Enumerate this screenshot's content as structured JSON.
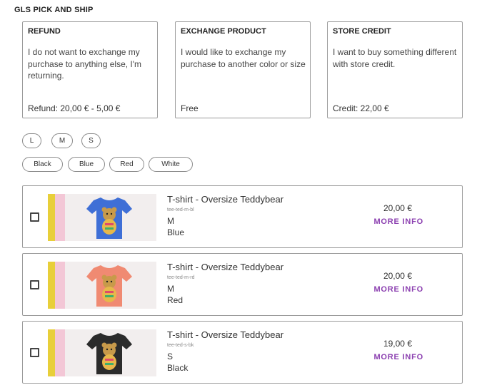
{
  "section_title": "GLS PICK AND SHIP",
  "options": [
    {
      "title": "REFUND",
      "description": "I do not want to exchange my purchase to anything else, I'm returning.",
      "price": "Refund: 20,00 € - 5,00 €"
    },
    {
      "title": "EXCHANGE PRODUCT",
      "description": "I would like to exchange my purchase to another color or size",
      "price": "Free"
    },
    {
      "title": "STORE CREDIT",
      "description": "I want to buy something different with store credit.",
      "price": "Credit: 22,00 €"
    }
  ],
  "size_filters": [
    "L",
    "M",
    "S"
  ],
  "color_filters": [
    "Black",
    "Blue",
    "Red",
    "White"
  ],
  "products": [
    {
      "name": "T-shirt - Oversize Teddybear",
      "sku": "tee-ted-m-bl",
      "size": "M",
      "color": "Blue",
      "price": "20,00 €",
      "more_info": "MORE INFO",
      "shirt_color": "#3f6fd6"
    },
    {
      "name": "T-shirt - Oversize Teddybear",
      "sku": "tee-ted-m-rd",
      "size": "M",
      "color": "Red",
      "price": "20,00 €",
      "more_info": "MORE INFO",
      "shirt_color": "#f08a72"
    },
    {
      "name": "T-shirt - Oversize Teddybear",
      "sku": "tee-ted-s-bk",
      "size": "S",
      "color": "Black",
      "price": "19,00 €",
      "more_info": "MORE INFO",
      "shirt_color": "#2b2b2b"
    }
  ],
  "colors": {
    "accent": "#8b3fb0",
    "border": "#9a9a9a",
    "thumb_yellow": "#e8cf3a",
    "thumb_pink": "#f3c7d6"
  },
  "icons": {
    "product_image": "t-shirt-teddybear-image",
    "checkbox": "checkbox"
  }
}
